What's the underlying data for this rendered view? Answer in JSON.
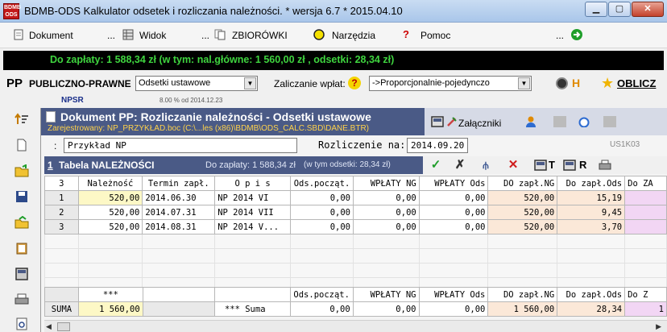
{
  "window": {
    "title": "BDMB-ODS Kalkulator odsetek i rozliczania należności.  * wersja 6.7 * 2015.04.10",
    "logo_text": "BDMB ODS"
  },
  "menu": {
    "dokument": "Dokument",
    "dots1": "...",
    "widok": "Widok",
    "dots2": "...",
    "zbiorowki": "ZBIORÓWKI",
    "narzedzia": "Narzędzia",
    "pomoc": "Pomoc",
    "dots3": "..."
  },
  "summary_bar": "Do zapłaty: 1 588,34 zł   (w tym:  nal.główne: 1 560,00 zł ,  odsetki: 28,34 zł)",
  "pp_row": {
    "code": "PP",
    "type": "PUBLICZNO-PRAWNE",
    "interest_type": "Odsetki ustawowe",
    "payment_label": "Zaliczanie wpłat:",
    "payment_mode": "->Proporcjonalnie-pojedynczo",
    "h_label": "H",
    "oblicz": "OBLICZ",
    "npsr": "NPSR",
    "rate_note": "8.00 % od 2014.12.23"
  },
  "document": {
    "title": "Dokument PP: Rozliczanie należności - Odsetki ustawowe",
    "registered": "Zarejestrowany: NP_PRZYKŁAD.boc (C:\\...les (x86)\\BDMB\\ODS_CALC.SBD\\DANE.BTR)",
    "attachments": "Załączniki",
    "name_colon": ":",
    "name_value": "Przykład NP",
    "settlement_label": "Rozliczenie na:",
    "settlement_date": "2014.09.20",
    "code": "US1K03"
  },
  "table": {
    "number": "1",
    "name": "Tabela NALEŻNOŚCI",
    "due": "Do zapłaty: 1 588,34 zł",
    "interest": "(w tym odsetki: 28,34 zł)",
    "tool_t": "T",
    "tool_r": "R",
    "columns": [
      "3",
      "Należność",
      "Termin zapł.",
      "O p i s",
      "Ods.począt.",
      "WPŁATY NG",
      "WPŁATY Ods",
      "DO zapł.NG",
      "Do zapł.Ods",
      "Do ZA"
    ],
    "rows": [
      [
        "1",
        "520,00",
        "2014.06.30",
        "NP 2014 VI",
        "0,00",
        "0,00",
        "0,00",
        "520,00",
        "15,19",
        ""
      ],
      [
        "2",
        "520,00",
        "2014.07.31",
        "NP 2014 VII",
        "0,00",
        "0,00",
        "0,00",
        "520,00",
        "9,45",
        ""
      ],
      [
        "3",
        "520,00",
        "2014.08.31",
        "NP 2014 V...",
        "0,00",
        "0,00",
        "0,00",
        "520,00",
        "3,70",
        ""
      ]
    ],
    "sum_header": [
      "",
      "***",
      "",
      "",
      "Ods.począt.",
      "WPŁATY NG",
      "WPŁATY Ods",
      "DO zapł.NG",
      "Do zapł.Ods",
      "Do Z"
    ],
    "sum_row": [
      "SUMA",
      "1 560,00",
      "",
      "*** Suma",
      "0,00",
      "0,00",
      "0,00",
      "1 560,00",
      "28,34",
      "1"
    ]
  }
}
